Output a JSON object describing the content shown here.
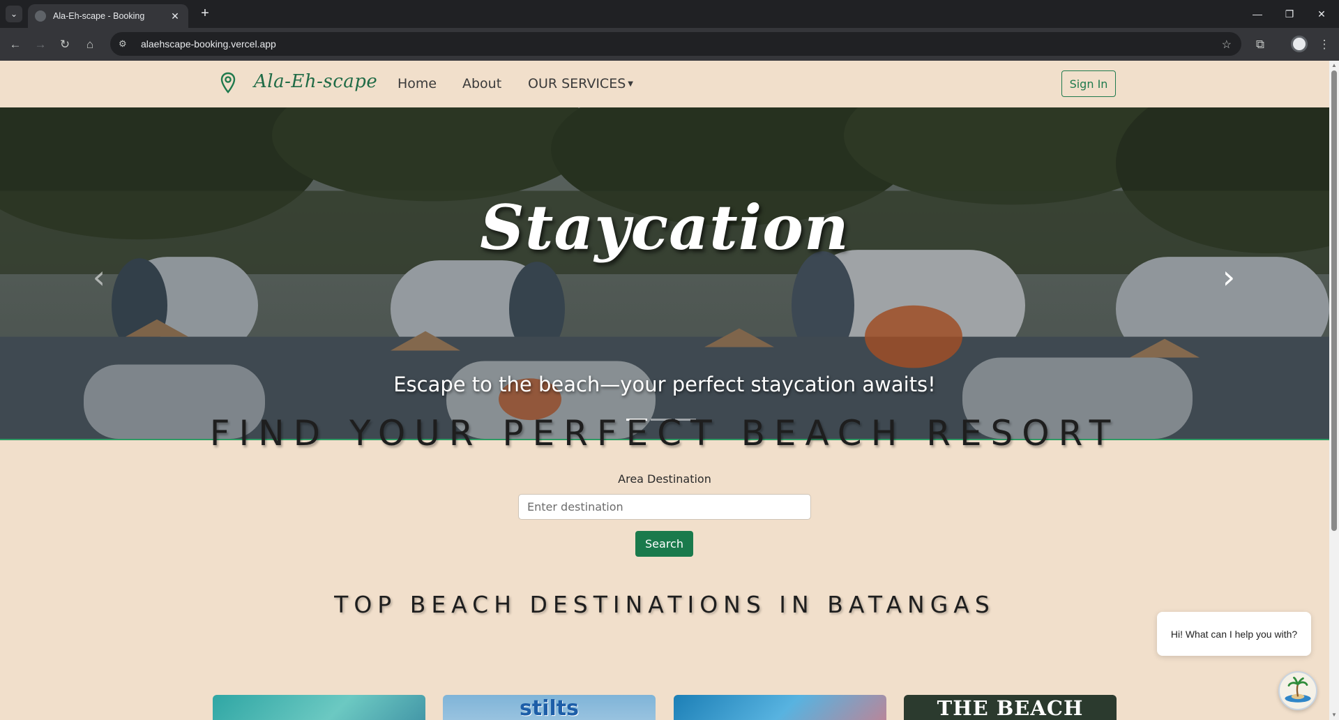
{
  "browser": {
    "tab_title": "Ala-Eh-scape - Booking",
    "url": "alaehscape-booking.vercel.app"
  },
  "nav": {
    "brand": "Ala-Eh-scape",
    "links": [
      "Home",
      "About",
      "OUR SERVICES"
    ],
    "signin": "Sign In"
  },
  "hero": {
    "title": "Staycation",
    "subtitle": "Escape to the beach—your perfect staycation awaits!",
    "slide_count": 3,
    "active_slide": 0
  },
  "search": {
    "heading": "FIND YOUR PERFECT BEACH RESORT",
    "label": "Area Destination",
    "placeholder": "Enter destination",
    "button": "Search"
  },
  "destinations": {
    "heading": "TOP BEACH DESTINATIONS IN BATANGAS",
    "cards": [
      "",
      "stilts",
      "",
      "THE BEACH CAMP"
    ]
  },
  "chat": {
    "greeting": "Hi! What can I help you with?"
  },
  "colors": {
    "page_bg": "#f1dfcb",
    "brand_green": "#1f6b46",
    "button_green": "#1a7a4c"
  }
}
